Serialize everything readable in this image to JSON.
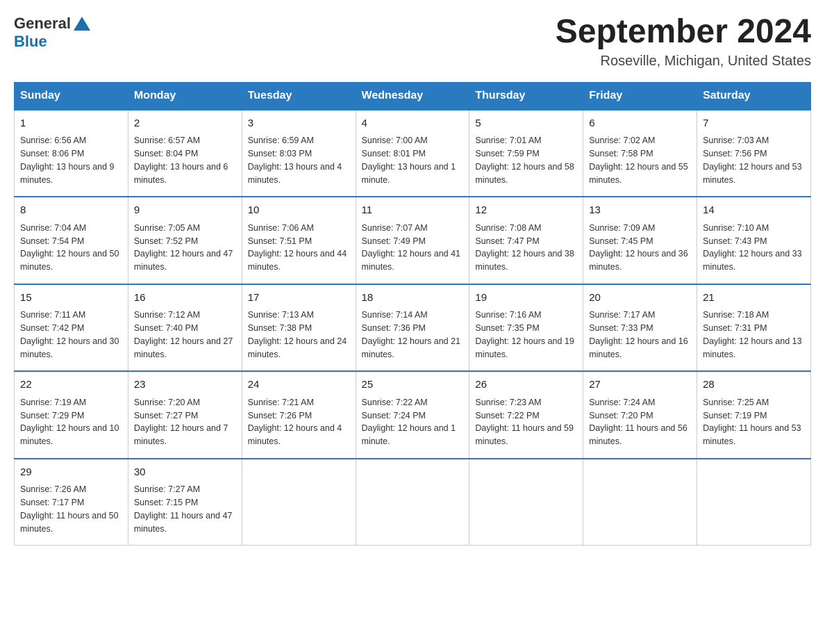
{
  "header": {
    "logo_general": "General",
    "logo_blue": "Blue",
    "month_title": "September 2024",
    "location": "Roseville, Michigan, United States"
  },
  "days_of_week": [
    "Sunday",
    "Monday",
    "Tuesday",
    "Wednesday",
    "Thursday",
    "Friday",
    "Saturday"
  ],
  "weeks": [
    [
      {
        "day": "1",
        "sunrise": "6:56 AM",
        "sunset": "8:06 PM",
        "daylight": "13 hours and 9 minutes."
      },
      {
        "day": "2",
        "sunrise": "6:57 AM",
        "sunset": "8:04 PM",
        "daylight": "13 hours and 6 minutes."
      },
      {
        "day": "3",
        "sunrise": "6:59 AM",
        "sunset": "8:03 PM",
        "daylight": "13 hours and 4 minutes."
      },
      {
        "day": "4",
        "sunrise": "7:00 AM",
        "sunset": "8:01 PM",
        "daylight": "13 hours and 1 minute."
      },
      {
        "day": "5",
        "sunrise": "7:01 AM",
        "sunset": "7:59 PM",
        "daylight": "12 hours and 58 minutes."
      },
      {
        "day": "6",
        "sunrise": "7:02 AM",
        "sunset": "7:58 PM",
        "daylight": "12 hours and 55 minutes."
      },
      {
        "day": "7",
        "sunrise": "7:03 AM",
        "sunset": "7:56 PM",
        "daylight": "12 hours and 53 minutes."
      }
    ],
    [
      {
        "day": "8",
        "sunrise": "7:04 AM",
        "sunset": "7:54 PM",
        "daylight": "12 hours and 50 minutes."
      },
      {
        "day": "9",
        "sunrise": "7:05 AM",
        "sunset": "7:52 PM",
        "daylight": "12 hours and 47 minutes."
      },
      {
        "day": "10",
        "sunrise": "7:06 AM",
        "sunset": "7:51 PM",
        "daylight": "12 hours and 44 minutes."
      },
      {
        "day": "11",
        "sunrise": "7:07 AM",
        "sunset": "7:49 PM",
        "daylight": "12 hours and 41 minutes."
      },
      {
        "day": "12",
        "sunrise": "7:08 AM",
        "sunset": "7:47 PM",
        "daylight": "12 hours and 38 minutes."
      },
      {
        "day": "13",
        "sunrise": "7:09 AM",
        "sunset": "7:45 PM",
        "daylight": "12 hours and 36 minutes."
      },
      {
        "day": "14",
        "sunrise": "7:10 AM",
        "sunset": "7:43 PM",
        "daylight": "12 hours and 33 minutes."
      }
    ],
    [
      {
        "day": "15",
        "sunrise": "7:11 AM",
        "sunset": "7:42 PM",
        "daylight": "12 hours and 30 minutes."
      },
      {
        "day": "16",
        "sunrise": "7:12 AM",
        "sunset": "7:40 PM",
        "daylight": "12 hours and 27 minutes."
      },
      {
        "day": "17",
        "sunrise": "7:13 AM",
        "sunset": "7:38 PM",
        "daylight": "12 hours and 24 minutes."
      },
      {
        "day": "18",
        "sunrise": "7:14 AM",
        "sunset": "7:36 PM",
        "daylight": "12 hours and 21 minutes."
      },
      {
        "day": "19",
        "sunrise": "7:16 AM",
        "sunset": "7:35 PM",
        "daylight": "12 hours and 19 minutes."
      },
      {
        "day": "20",
        "sunrise": "7:17 AM",
        "sunset": "7:33 PM",
        "daylight": "12 hours and 16 minutes."
      },
      {
        "day": "21",
        "sunrise": "7:18 AM",
        "sunset": "7:31 PM",
        "daylight": "12 hours and 13 minutes."
      }
    ],
    [
      {
        "day": "22",
        "sunrise": "7:19 AM",
        "sunset": "7:29 PM",
        "daylight": "12 hours and 10 minutes."
      },
      {
        "day": "23",
        "sunrise": "7:20 AM",
        "sunset": "7:27 PM",
        "daylight": "12 hours and 7 minutes."
      },
      {
        "day": "24",
        "sunrise": "7:21 AM",
        "sunset": "7:26 PM",
        "daylight": "12 hours and 4 minutes."
      },
      {
        "day": "25",
        "sunrise": "7:22 AM",
        "sunset": "7:24 PM",
        "daylight": "12 hours and 1 minute."
      },
      {
        "day": "26",
        "sunrise": "7:23 AM",
        "sunset": "7:22 PM",
        "daylight": "11 hours and 59 minutes."
      },
      {
        "day": "27",
        "sunrise": "7:24 AM",
        "sunset": "7:20 PM",
        "daylight": "11 hours and 56 minutes."
      },
      {
        "day": "28",
        "sunrise": "7:25 AM",
        "sunset": "7:19 PM",
        "daylight": "11 hours and 53 minutes."
      }
    ],
    [
      {
        "day": "29",
        "sunrise": "7:26 AM",
        "sunset": "7:17 PM",
        "daylight": "11 hours and 50 minutes."
      },
      {
        "day": "30",
        "sunrise": "7:27 AM",
        "sunset": "7:15 PM",
        "daylight": "11 hours and 47 minutes."
      },
      null,
      null,
      null,
      null,
      null
    ]
  ]
}
